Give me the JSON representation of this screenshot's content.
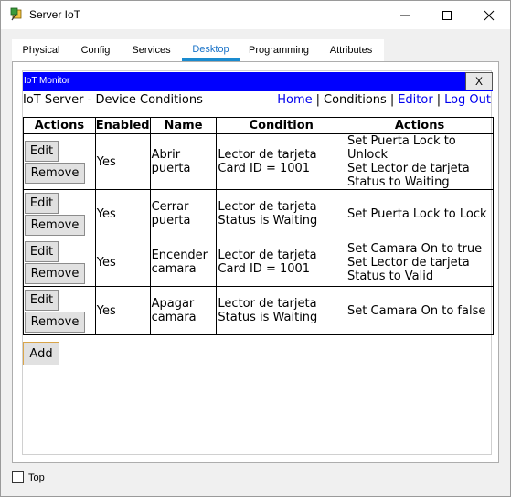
{
  "window": {
    "title": "Server IoT"
  },
  "tabs": [
    {
      "label": "Physical",
      "active": false
    },
    {
      "label": "Config",
      "active": false
    },
    {
      "label": "Services",
      "active": false
    },
    {
      "label": "Desktop",
      "active": true
    },
    {
      "label": "Programming",
      "active": false
    },
    {
      "label": "Attributes",
      "active": false
    }
  ],
  "monitor": {
    "title": "IoT Monitor",
    "close_label": "X"
  },
  "page": {
    "heading": "IoT Server - Device Conditions",
    "nav": {
      "home": "Home",
      "conditions": "Conditions",
      "editor": "Editor",
      "logout": "Log Out",
      "sep": "|"
    }
  },
  "table": {
    "headers": [
      "Actions",
      "Enabled",
      "Name",
      "Condition",
      "Actions"
    ],
    "edit_label": "Edit",
    "remove_label": "Remove",
    "rows": [
      {
        "enabled": "Yes",
        "name": "Abrir puerta",
        "condition": "Lector de tarjeta Card ID = 1001",
        "actions": [
          "Set Puerta Lock to Unlock",
          "Set Lector de tarjeta Status to Waiting"
        ]
      },
      {
        "enabled": "Yes",
        "name": "Cerrar puerta",
        "condition": "Lector de tarjeta Status is Waiting",
        "actions": [
          "Set Puerta Lock to Lock"
        ]
      },
      {
        "enabled": "Yes",
        "name": "Encender camara",
        "condition": "Lector de tarjeta Card ID = 1001",
        "actions": [
          "Set Camara On to true",
          "Set Lector de tarjeta Status to Valid"
        ]
      },
      {
        "enabled": "Yes",
        "name": "Apagar camara",
        "condition": "Lector de tarjeta Status is Waiting",
        "actions": [
          "Set Camara On to false"
        ]
      }
    ]
  },
  "add_label": "Add",
  "footer": {
    "top_label": "Top",
    "top_checked": false
  }
}
